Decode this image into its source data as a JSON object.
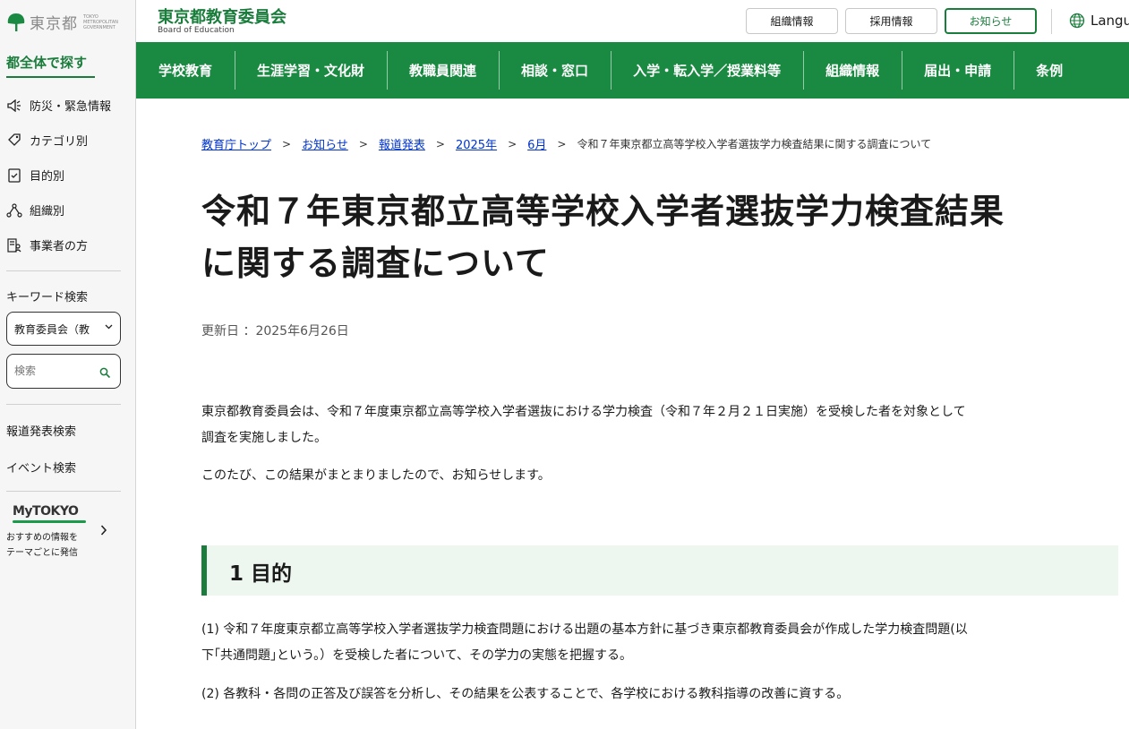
{
  "logo": {
    "name": "東京都",
    "en": "TOKYO METROPOLITAN GOVERNMENT"
  },
  "sidebar": {
    "title": "都全体で探す",
    "items": [
      {
        "label": "防災・緊急情報",
        "icon": "megaphone-icon"
      },
      {
        "label": "カテゴリ別",
        "icon": "tag-icon"
      },
      {
        "label": "目的別",
        "icon": "checklist-icon"
      },
      {
        "label": "組織別",
        "icon": "org-chart-icon"
      },
      {
        "label": "事業者の方",
        "icon": "business-person-icon"
      }
    ],
    "keyword_label": "キーワード検索",
    "select_value": "教育委員会（教",
    "search_placeholder": "検索",
    "links": [
      "報道発表検索",
      "イベント検索"
    ],
    "mytokyo": {
      "logo": "MyTOKYO",
      "desc_line1": "おすすめの情報を",
      "desc_line2": "テーマごとに発信"
    }
  },
  "header": {
    "title": "東京都教育委員会",
    "subtitle": "Board of Education",
    "buttons": [
      "組織情報",
      "採用情報",
      "お知らせ"
    ],
    "language": "Langu"
  },
  "nav": [
    "学校教育",
    "生涯学習・文化財",
    "教職員関連",
    "相談・窓口",
    "入学・転入学／授業料等",
    "組織情報",
    "届出・申請",
    "条例"
  ],
  "breadcrumb": {
    "links": [
      "教育庁トップ",
      "お知らせ",
      "報道発表",
      "2025年",
      "6月"
    ],
    "current": "令和７年東京都立高等学校入学者選抜学力検査結果に関する調査について"
  },
  "page": {
    "title_line1": "令和７年東京都立高等学校入学者選抜学力検査結果",
    "title_line2": "に関する調査について",
    "updated": "更新日 ：2025年6月26日",
    "intro_line1": "東京都教育委員会は、令和７年度東京都立高等学校入学者選抜における学力検査（令和７年２月２１日実施）を受検した者を対象として",
    "intro_line2": "調査を実施しました。",
    "intro2": "このたび、この結果がまとまりましたので、お知らせします。",
    "section1_title": "1 目的",
    "purpose1_line1": "(1) 令和７年度東京都立高等学校入学者選抜学力検査問題における出題の基本方針に基づき東京都教育委員会が作成した学力検査問題(以",
    "purpose1_line2": "下｢共通問題｣という。）を受検した者について、その学力の実態を把握する。",
    "purpose2": "(2) 各教科・各問の正答及び誤答を分析し、その結果を公表することで、各学校における教科指導の改善に資する。"
  },
  "colors": {
    "brand_green": "#1a7d3c",
    "nav_green": "#1a8a42",
    "link_blue": "#0033cc",
    "section_bg": "#eef6f0"
  }
}
